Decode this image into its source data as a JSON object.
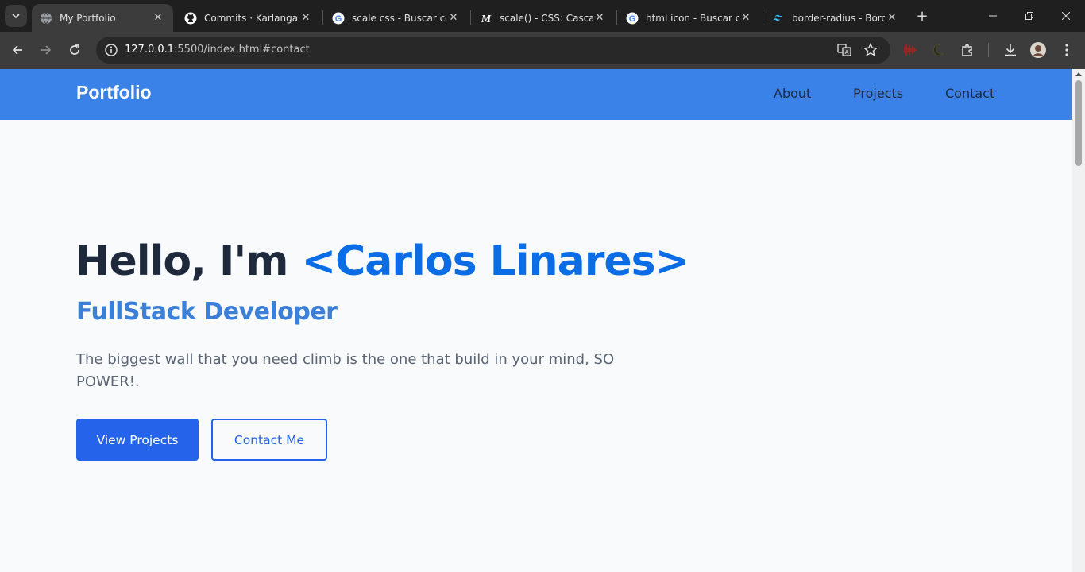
{
  "browser": {
    "tabs": [
      {
        "title": "My Portfolio",
        "favicon": "globe-icon",
        "active": true
      },
      {
        "title": "Commits · KarlangaXZ",
        "favicon": "github-icon",
        "active": false
      },
      {
        "title": "scale css - Buscar con",
        "favicon": "google-icon",
        "active": false
      },
      {
        "title": "scale() - CSS: Cascadin",
        "favicon": "mdn-icon",
        "active": false
      },
      {
        "title": "html icon - Buscar con",
        "favicon": "google-icon",
        "active": false
      },
      {
        "title": "border-radius - Borde",
        "favicon": "tailwind-icon",
        "active": false
      }
    ],
    "address": {
      "host": "127.0.0.1",
      "path": ":5500/index.html#contact"
    }
  },
  "site": {
    "brand": "Portfolio",
    "nav": [
      "About",
      "Projects",
      "Contact"
    ],
    "hero": {
      "greeting": "Hello, I'm ",
      "name": "<Carlos Linares>",
      "subtitle": "FullStack Developer",
      "quote": "The biggest wall that you need climb is the one that build in your mind, SO POWER!.",
      "primary_button": "View Projects",
      "secondary_button": "Contact Me"
    }
  },
  "colors": {
    "nav_bar": "#3b82e8",
    "accent": "#0a6de6",
    "button": "#2563eb",
    "page_bg": "#f8fafc"
  }
}
